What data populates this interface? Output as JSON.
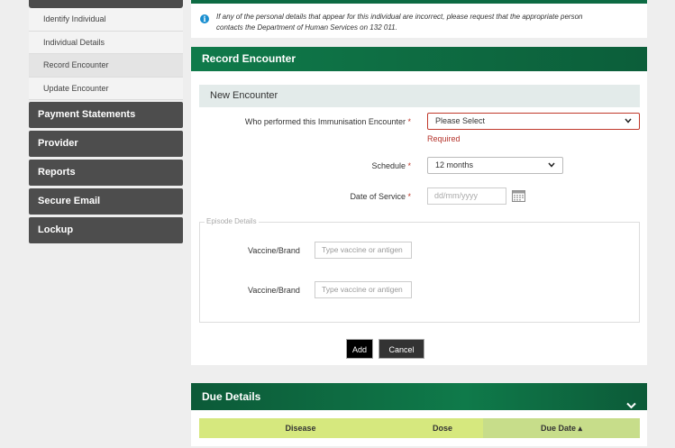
{
  "sidebar": {
    "sub_items": [
      {
        "label": "Identify Individual"
      },
      {
        "label": "Individual Details"
      },
      {
        "label": "Record Encounter"
      },
      {
        "label": "Update Encounter"
      }
    ],
    "main_items": [
      {
        "label": "Payment Statements"
      },
      {
        "label": "Provider"
      },
      {
        "label": "Reports"
      },
      {
        "label": "Secure Email"
      },
      {
        "label": "Lockup"
      }
    ]
  },
  "info": {
    "text_line1": "If any of the personal details that appear for this individual are incorrect, please request that the appropriate person",
    "text_line2": "contacts the Department of Human Services on 132 011."
  },
  "record_encounter": {
    "title": "Record Encounter",
    "subtitle": "New Encounter",
    "performer": {
      "label": "Who performed this Immunisation Encounter",
      "required_mark": "*",
      "value": "Please Select",
      "error": "Required"
    },
    "schedule": {
      "label": "Schedule",
      "required_mark": "*",
      "value": "12 months"
    },
    "date_of_service": {
      "label": "Date of Service",
      "required_mark": "*",
      "placeholder": "dd/mm/yyyy"
    },
    "episode_details": {
      "legend": "Episode Details",
      "rows": [
        {
          "label": "Vaccine/Brand",
          "placeholder": "Type vaccine or antigen"
        },
        {
          "label": "Vaccine/Brand",
          "placeholder": "Type vaccine or antigen"
        }
      ]
    },
    "add_label": "Add",
    "cancel_label": "Cancel"
  },
  "due_details": {
    "title": "Due Details",
    "columns": [
      "Disease",
      "Dose",
      "Due Date ▴"
    ]
  },
  "colors": {
    "brand_green": "#0f7a4a",
    "error_red": "#c0392b",
    "table_header": "#d6e87e"
  }
}
